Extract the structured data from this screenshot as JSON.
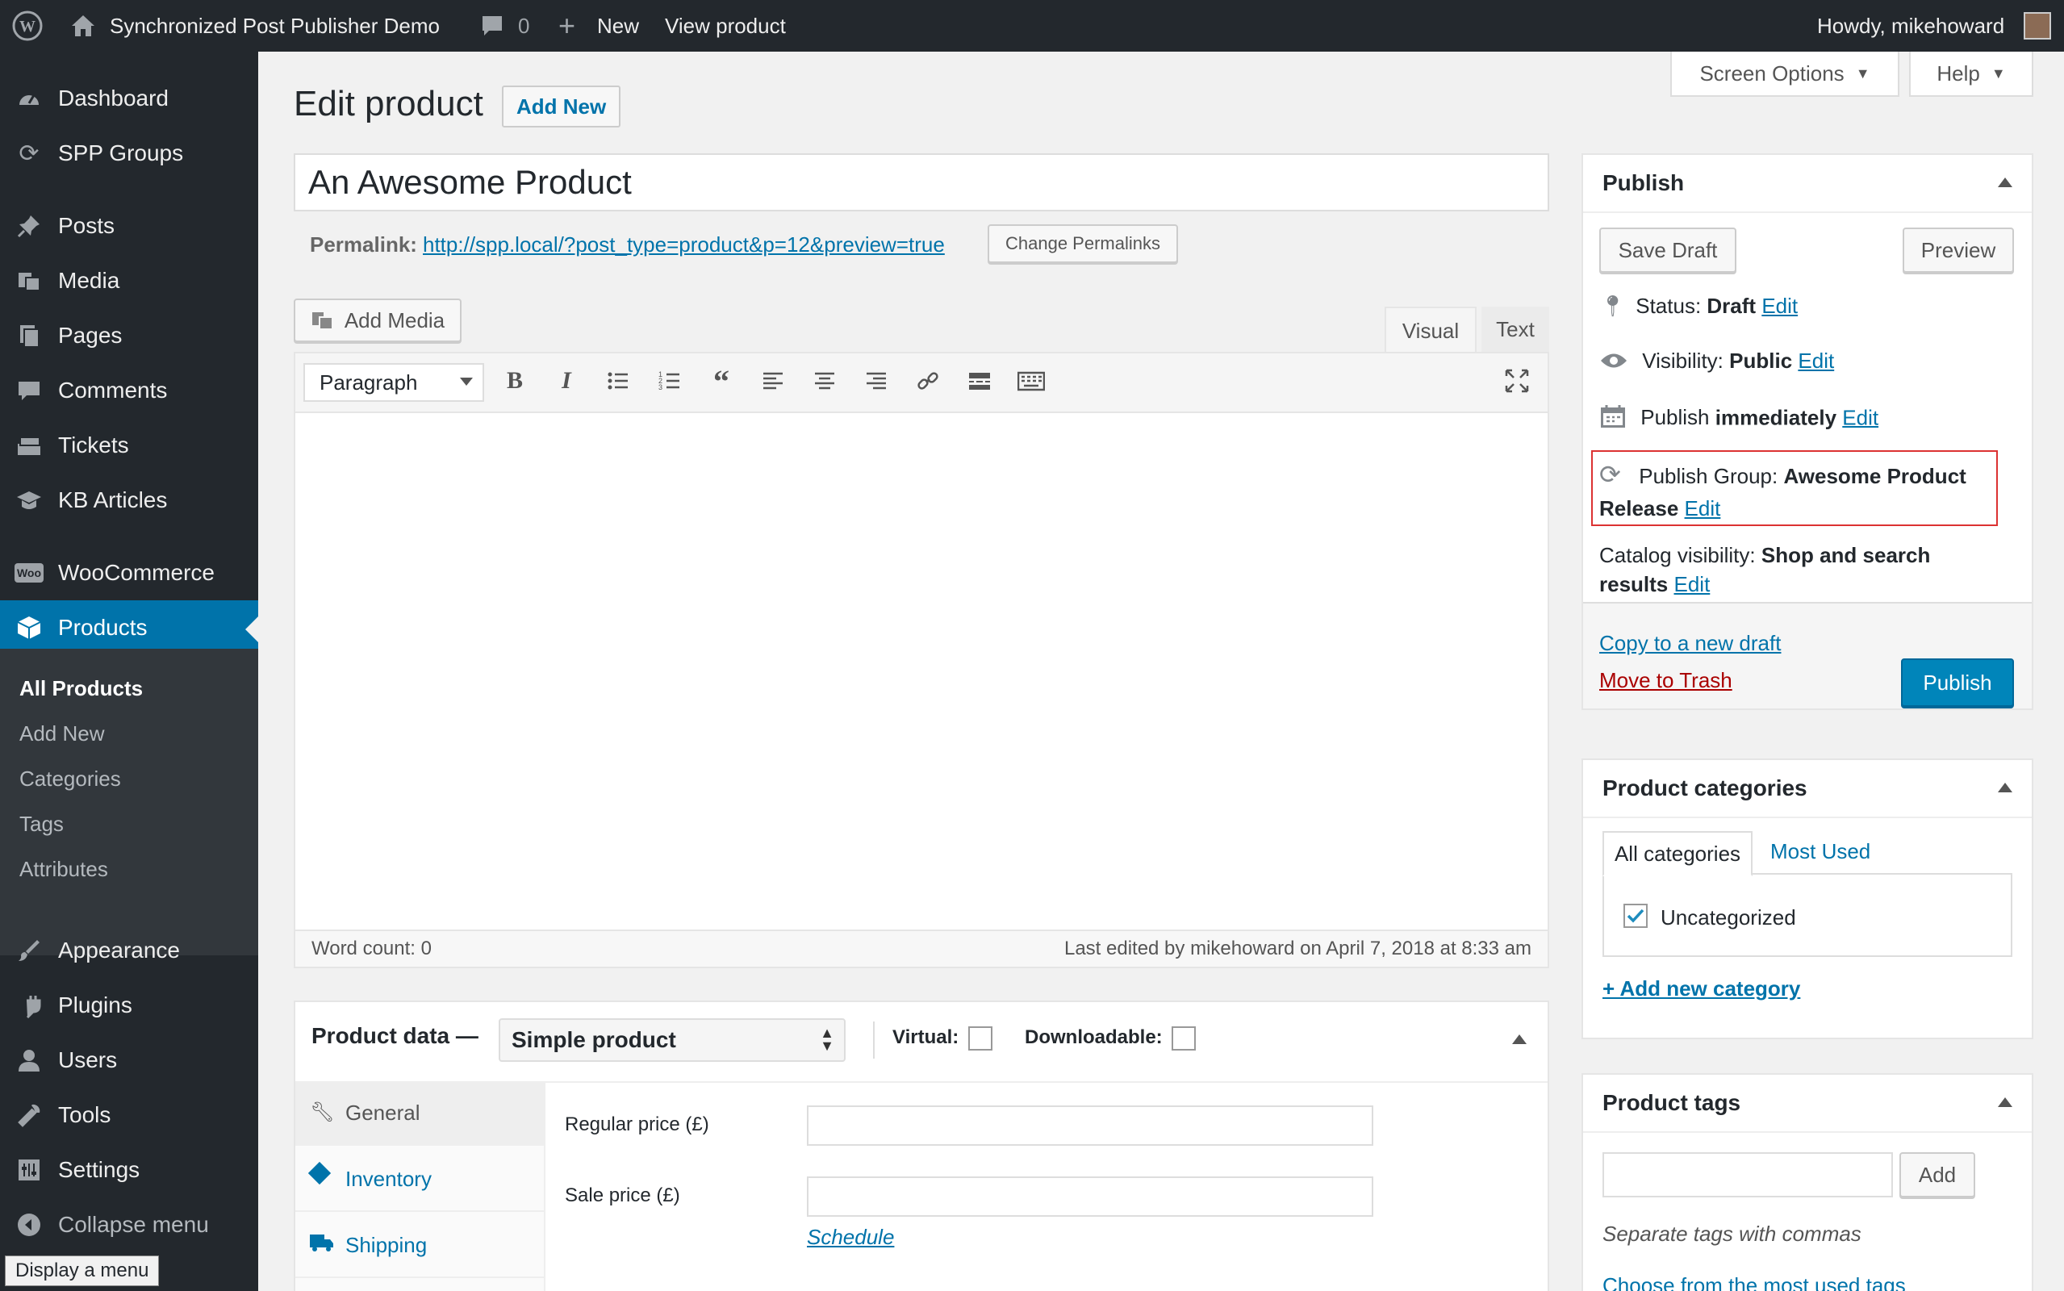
{
  "adminbar": {
    "site_name": "Synchronized Post Publisher Demo",
    "comments_count": "0",
    "new_label": "New",
    "view_label": "View product",
    "howdy": "Howdy, mikehoward"
  },
  "sidebar": {
    "items": [
      {
        "label": "Dashboard",
        "icon": "dashboard-icon"
      },
      {
        "label": "SPP Groups",
        "icon": "sync-icon"
      },
      {
        "label": "Posts",
        "icon": "pin-icon"
      },
      {
        "label": "Media",
        "icon": "media-icon"
      },
      {
        "label": "Pages",
        "icon": "pages-icon"
      },
      {
        "label": "Comments",
        "icon": "comment-icon"
      },
      {
        "label": "Tickets",
        "icon": "tickets-icon"
      },
      {
        "label": "KB Articles",
        "icon": "graduation-cap-icon"
      },
      {
        "label": "WooCommerce",
        "icon": "woo-icon"
      },
      {
        "label": "Products",
        "icon": "box-icon"
      },
      {
        "label": "Appearance",
        "icon": "brush-icon"
      },
      {
        "label": "Plugins",
        "icon": "plugin-icon"
      },
      {
        "label": "Users",
        "icon": "user-icon"
      },
      {
        "label": "Tools",
        "icon": "wrench-icon"
      },
      {
        "label": "Settings",
        "icon": "settings-icon"
      },
      {
        "label": "Collapse menu",
        "icon": "collapse-icon"
      }
    ],
    "woo_badge": "Woo",
    "submenu": [
      "All Products",
      "Add New",
      "Categories",
      "Tags",
      "Attributes"
    ],
    "tooltip": "Display a menu"
  },
  "screen_options": "Screen Options",
  "help": "Help",
  "page_title": "Edit product",
  "add_new": "Add New",
  "post_title": "An Awesome Product",
  "permalink": {
    "label": "Permalink:",
    "url": "http://spp.local/?post_type=product&p=12&preview=true",
    "change_button": "Change Permalinks"
  },
  "editor": {
    "add_media": "Add Media",
    "tab_visual": "Visual",
    "tab_text": "Text",
    "format_select": "Paragraph",
    "toolbar_bold": "B",
    "toolbar_italic": "I",
    "word_count": "Word count: 0",
    "last_edited": "Last edited by mikehoward on April 7, 2018 at 8:33 am"
  },
  "product_data": {
    "title": "Product data —",
    "type": "Simple product",
    "virtual_label": "Virtual:",
    "downloadable_label": "Downloadable:",
    "tabs": [
      "General",
      "Inventory",
      "Shipping"
    ],
    "regular_price_label": "Regular price (£)",
    "sale_price_label": "Sale price (£)",
    "schedule_link": "Schedule"
  },
  "publish": {
    "title": "Publish",
    "save_draft": "Save Draft",
    "preview": "Preview",
    "status_label": "Status:",
    "status_value": "Draft",
    "visibility_label": "Visibility:",
    "visibility_value": "Public",
    "publish_label": "Publish",
    "publish_value": "immediately",
    "group_label": "Publish Group:",
    "group_value_1": "Awesome Product",
    "group_value_2": "Release",
    "catalog_label": "Catalog visibility:",
    "catalog_value_1": "Shop and search",
    "catalog_value_2": "results",
    "edit": "Edit",
    "copy_draft": "Copy to a new draft",
    "trash": "Move to Trash",
    "publish_button": "Publish"
  },
  "categories": {
    "title": "Product categories",
    "tab_all": "All categories",
    "tab_most_used": "Most Used",
    "item": "Uncategorized",
    "add_new": "+ Add new category"
  },
  "tags": {
    "title": "Product tags",
    "add_button": "Add",
    "hint": "Separate tags with commas",
    "choose": "Choose from the most used tags"
  },
  "colors": {
    "admin_bg": "#23282d",
    "accent": "#0073aa",
    "highlight_box": "#dc3232",
    "publish_btn": "#0085ba"
  }
}
